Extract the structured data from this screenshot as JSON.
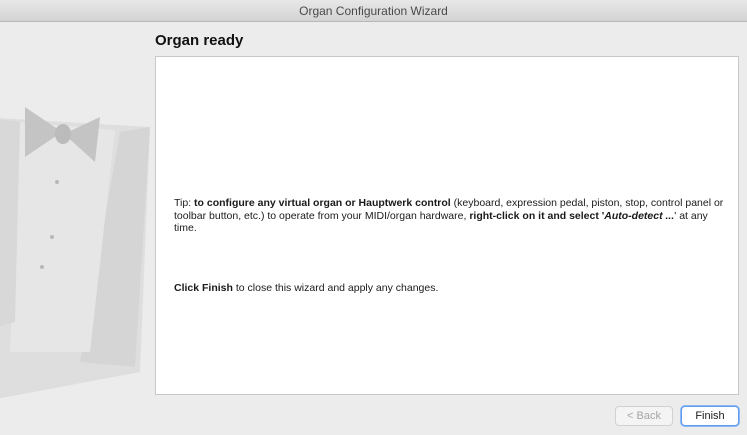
{
  "window": {
    "title": "Organ Configuration Wizard"
  },
  "page": {
    "heading": "Organ ready"
  },
  "tip": {
    "prefix": "Tip: ",
    "bold1": "to configure any virtual organ or Hauptwerk control",
    "mid": " (keyboard, expression pedal, piston, stop, control panel or toolbar button, etc.) to operate from your MIDI/organ hardware, ",
    "bold2": "right-click on it and select '",
    "bolditalic": "Auto-detect ...",
    "suffix": "' at any time."
  },
  "finish_note": {
    "bold": "Click Finish",
    "rest": " to close this wizard and apply any changes."
  },
  "buttons": {
    "back": "< Back",
    "finish": "Finish"
  },
  "colors": {
    "accent": "#5e9bf0",
    "panel_bg": "#ffffff",
    "window_bg": "#ececec"
  },
  "icons": [
    "tuxedo-illustration"
  ]
}
